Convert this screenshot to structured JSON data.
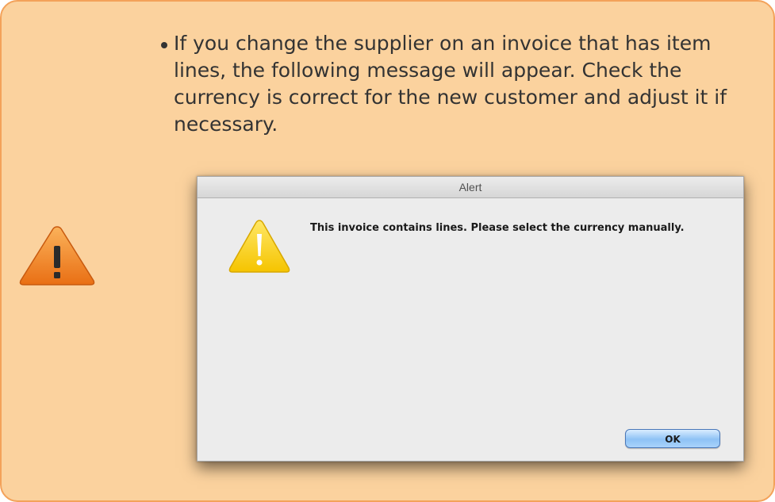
{
  "note": {
    "icon": "warning-triangle-icon",
    "bullets": [
      "If you change the supplier on an invoice that has item lines, the following message will appear. Check the currency is correct for the new customer and adjust it if necessary."
    ]
  },
  "alert": {
    "title": "Alert",
    "icon": "warning-triangle-icon",
    "message": "This invoice contains lines. Please select the currency manually.",
    "ok_label": "OK"
  },
  "colors": {
    "callout_background": "#fbd29e",
    "callout_border": "#f3a25a",
    "warning_orange": "#f08a24",
    "alert_yellow": "#fbd420",
    "ok_button_blue": "#8ec2f5"
  }
}
